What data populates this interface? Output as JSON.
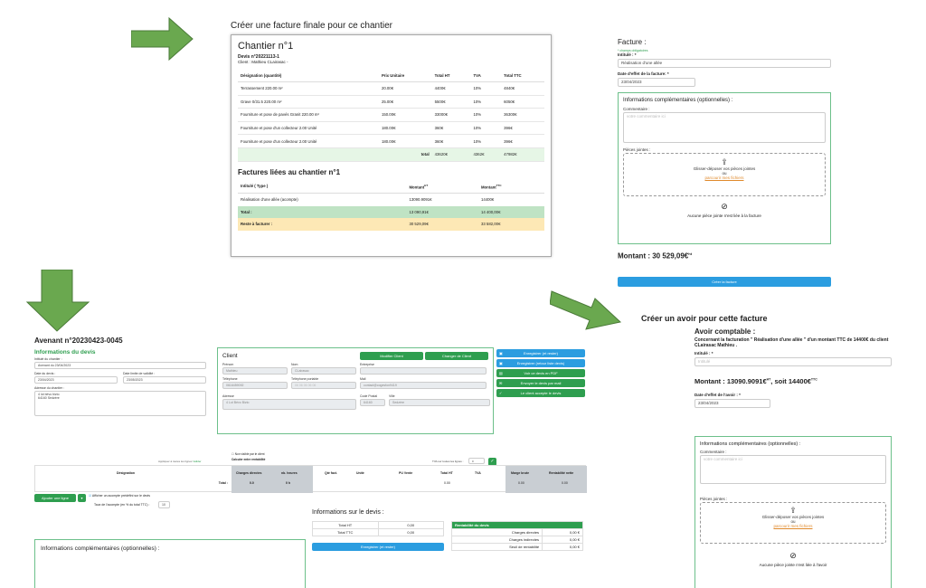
{
  "top_title": "Créer une facture finale pour ce chantier",
  "chantier": {
    "title": "Chantier n°1",
    "devis": "Devis n°20221113-1",
    "client": "Client : Mathieu CLairasac -",
    "headers": [
      "Désignation (quantité)",
      "Prix Unitaire",
      "Total HT",
      "TVA",
      "Total TTC"
    ],
    "rows": [
      [
        "Terrassement 220.00 m²",
        "20.00€",
        "4400€",
        "10%",
        "4840€"
      ],
      [
        "Grave 0/31.5 220.00 m²",
        "25.00€",
        "5500€",
        "10%",
        "6050€"
      ],
      [
        "Fourniture et pose de pavés Granit 220.00 m²",
        "150.00€",
        "33000€",
        "10%",
        "36300€"
      ],
      [
        "Fourniture et pose d'un collecteur 2.00 Unité",
        "180.00€",
        "360€",
        "10%",
        "396€"
      ],
      [
        "Fourniture et pose d'un collecteur 2.00 Unité",
        "180.00€",
        "360€",
        "10%",
        "396€"
      ]
    ],
    "total_row": [
      "total",
      "43620€",
      "4362€",
      "47982€"
    ],
    "factures_title": "Factures liées au chantier n°1",
    "f_headers": [
      "Intitulé ( Type )",
      "Montant",
      "Montant"
    ],
    "f_header_sup": [
      "HT",
      "TTC"
    ],
    "f_rows": [
      [
        "Réalisation d'une allée (acompte)",
        "13090.9091€",
        "14400€"
      ]
    ],
    "f_total": [
      "Total :",
      "13 090,91€",
      "14 400,00€"
    ],
    "f_reste": [
      "Reste à facturer :",
      "30 529,09€",
      "33 582,00€"
    ]
  },
  "facture": {
    "title": "Facture :",
    "required_note": "* champs obligatoires",
    "intitule_label": "Intitulé : *",
    "intitule_value": "Réalisation d'une allée",
    "date_label": "Date d'effet de la facture: *",
    "date_value": "23/04/2023",
    "info_title": "Informations complémentaires (optionnelles) :",
    "comment_label": "Commentaire :",
    "comment_placeholder": "votre commentaire ici",
    "pj_label": "Pièces jointes :",
    "drop_text": "Glisser-déposer vos pièces jointes",
    "drop_ou": "ou",
    "drop_link": "parcourir mes fichiers",
    "no_pj": "Aucune pièce jointe n'est liée à la facture",
    "montant": "Montant : 30 529,09€",
    "montant_sup": "ht",
    "create_btn": "Créer la facture"
  },
  "avenant": {
    "title": "Avenant n°20230423-0045",
    "info_title": "Informations du devis",
    "intitule_label": "Intitulé du chantier :",
    "intitule_value": "Avenant du 23/04/2023",
    "date_label": "Date du devis :",
    "date_value": "23/04/2023",
    "limit_label": "Date limite de validité :",
    "limit_value": "23/05/2023",
    "adresse_label": "Adresse du chantier :",
    "adresse_value": "4 lot bévo bizto\n64160 Sedzère",
    "client_title": "Client",
    "modifier_btn": "Modifier Client",
    "changer_btn": "Changer de Client",
    "prenom_label": "Prénom",
    "prenom_value": "Mathieu",
    "nom_label": "Nom",
    "nom_value": "CLairasac",
    "entreprise_label": "Entreprise",
    "tel_label": "Téléphone",
    "tel_value": "0616459092",
    "portable_label": "Téléphone portable",
    "portable_value": "06 06 06 06 06",
    "mail_label": "Mail",
    "mail_value": "contact@cogesfon9419",
    "adr_label": "Adresse",
    "adr_value": "4 Lot Bévo Bizto",
    "cp_label": "Code Postal",
    "cp_value": "64160",
    "ville_label": "Ville",
    "ville_value": "Sedzère",
    "actions": [
      "Enregistrer (et rester)",
      "Enregistrer (retour liste devis)",
      "Voir ce devis en PDF",
      "Envoyer le devis par mail",
      "Le client accepte le devis"
    ],
    "non_visible": "Non visible par le client",
    "calc_label": "Calculer entre rentabilité",
    "ajout_ligne_hint": "Appliquer à toutes les lignes",
    "valider": "Valider",
    "tva_hint": "TVA sur toutes les lignes :",
    "tva_val": "0",
    "cols": [
      "Désignation",
      "Charges directes",
      "nb. heures",
      "Qté fact.",
      "Unité",
      "PU Vente",
      "Total HT",
      "TVA",
      "Marge brute",
      "Rentabilité nette"
    ],
    "total_label": "Total :",
    "total_vals": [
      "0.0",
      "0 h",
      "0.00",
      "0.00",
      "0.00"
    ],
    "ajouter_btn": "Ajouter une ligne",
    "acompte_check": "Afficher un acompte prédéfini sur le devis",
    "acompte_label": "Taux de l'acompte (en % du total TTC) :",
    "acompte_val": "10",
    "infos_devis_title": "Informations sur le devis :",
    "total_ht_label": "Total HT",
    "total_ht_val": "0,00",
    "total_ttc_label": "Total TTC",
    "total_ttc_val": "0,00",
    "save_btn": "Enregistrer (et rester)",
    "renta_title": "Rentabilité du devis",
    "renta_rows": [
      [
        "Charges directes",
        "0,00 €"
      ],
      [
        "Charges indirectes",
        "0,00 €"
      ],
      [
        "Seuil de rentabilité",
        "0,00 €"
      ]
    ],
    "info_compl": "Informations complémentaires (optionnelles) :"
  },
  "avoir": {
    "section_title": "Créer un avoir pour cette facture",
    "title": "Avoir comptable :",
    "concernant": "Concernant la facturation \" Réalisation d'une allée \" d'un montant TTC de 14400€ du client CLairasac Mathieu .",
    "intitule_label": "Intitulé : *",
    "intitule_placeholder": "Intitulé",
    "montant": "Montant : 13090.9091€",
    "montant_sup1": "HT",
    "montant_mid": ", soit 14400€",
    "montant_sup2": "TTC",
    "date_label": "Date d'effet de l'avoir : *",
    "date_value": "23/04/2023",
    "info_title": "Informations complémentaires (optionnelles) :",
    "comment_label": "Commentaire :",
    "comment_placeholder": "votre commentaire ici",
    "pj_label": "Pièces jointes :",
    "drop_text": "Glisser-déposer vos pièces jointes",
    "drop_ou": "ou",
    "drop_link": "parcourir mes fichiers",
    "no_pj": "Aucune pièce jointe n'est liée à l'avoir"
  },
  "colors": {
    "arrow": "#6aa84f",
    "green": "#2e9e4f",
    "blue": "#2b9de0"
  }
}
